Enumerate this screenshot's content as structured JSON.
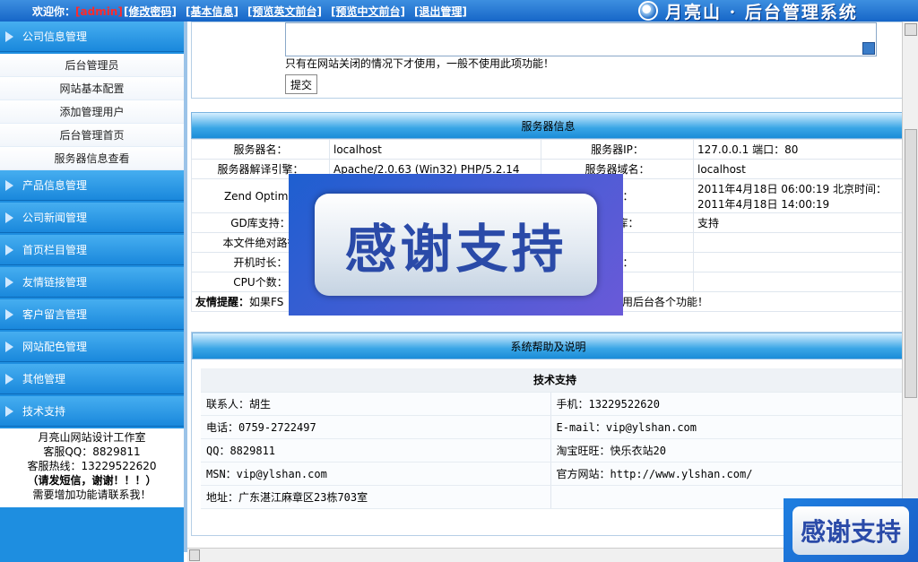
{
  "topbar": {
    "welcome_prefix": "欢迎你：",
    "user": "[admin]",
    "links": [
      "[修改密码]",
      "[基本信息]",
      "[预览英文前台]",
      "[预览中文前台]",
      "[退出管理]"
    ],
    "brand": "月亮山 · 后台管理系统"
  },
  "sidebar": {
    "sections": [
      {
        "label": "公司信息管理",
        "items": [
          "后台管理员",
          "网站基本配置",
          "添加管理用户",
          "后台管理首页",
          "服务器信息查看"
        ]
      },
      {
        "label": "产品信息管理"
      },
      {
        "label": "公司新闻管理"
      },
      {
        "label": "首页栏目管理"
      },
      {
        "label": "友情链接管理"
      },
      {
        "label": "客户留言管理"
      },
      {
        "label": "网站配色管理"
      },
      {
        "label": "其他管理"
      },
      {
        "label": "技术支持"
      }
    ],
    "contact": {
      "studio": "月亮山网站设计工作室",
      "qq": "客服QQ：8829811",
      "hotline": "客服热线：13229522620",
      "sms": "（请发短信，谢谢！！！）",
      "more": "需要增加功能请联系我！"
    }
  },
  "form": {
    "note": "只有在网站关闭的情况下才使用，一般不使用此项功能！",
    "submit": "提交"
  },
  "server": {
    "title": "服务器信息",
    "rows": [
      {
        "l1": "服务器名：",
        "v1": "localhost",
        "l2": "服务器IP：",
        "v2": "127.0.0.1 端口：80"
      },
      {
        "l1": "服务器解译引擎：",
        "v1": "Apache/2.0.63 (Win32) PHP/5.2.14",
        "l2": "服务器域名：",
        "v2": "localhost"
      },
      {
        "l1": "Zend Optimiz",
        "v1": "",
        "l2": "时间：",
        "v2a": "2011年4月18日  06:00:19 北京时间：",
        "v2b": "2011年4月18日  14:00:19"
      },
      {
        "l1": "GD库支持：",
        "v1": "",
        "l2": "数据库：",
        "v2": "支持"
      },
      {
        "l1": "本文件绝对路径",
        "v1": "",
        "l2": "",
        "v2": ""
      },
      {
        "l1": "开机时长：",
        "v1": "",
        "l2": "时区：",
        "v2": ""
      },
      {
        "l1": "CPU个数：",
        "v1": "",
        "l2": "型：",
        "v2": ""
      }
    ],
    "tip_label": "友情提醒：",
    "tip_start": "如果FS",
    "tip_end": "用后台各个功能！"
  },
  "help": {
    "title": "系统帮助及说明",
    "subtitle": "技术支持",
    "rows": [
      [
        "联系人：胡生",
        "手机：13229522620"
      ],
      [
        "电话：0759-2722497",
        "E-mail：vip@ylshan.com"
      ],
      [
        "QQ：8829811",
        "淘宝旺旺：快乐衣站20"
      ],
      [
        "MSN：vip@ylshan.com",
        "官方网站：http://www.ylshan.com/"
      ],
      [
        "地址：广东湛江麻章区23栋703室",
        ""
      ]
    ]
  },
  "overlay": {
    "big": "感谢支持",
    "small": "感谢支持"
  },
  "colors": {
    "accent": "#1e8ee0",
    "user_highlight": "#ff2a2a"
  }
}
